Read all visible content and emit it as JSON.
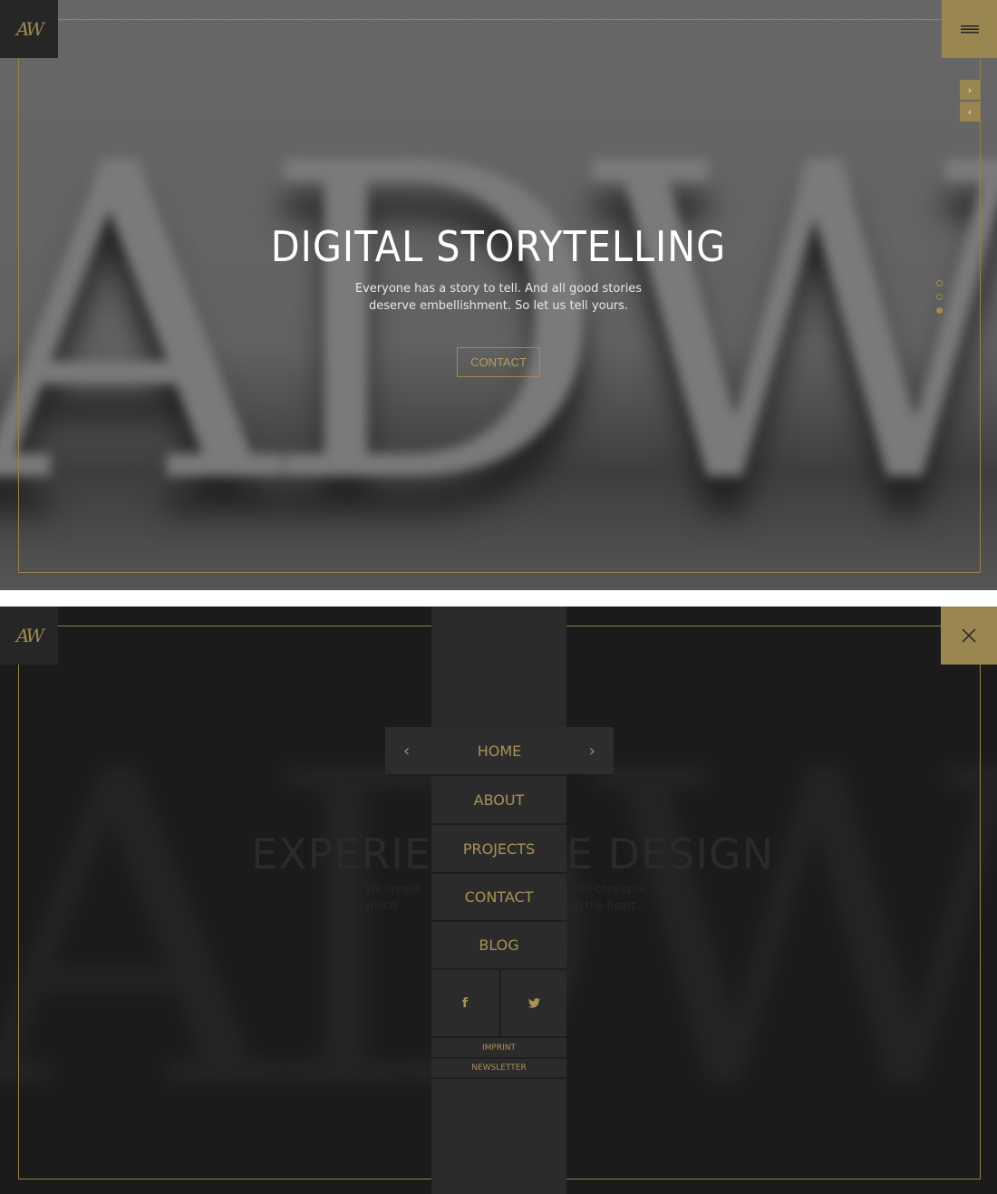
{
  "brand": {
    "logo_text": "AW",
    "accent": "#9a8650"
  },
  "slide1": {
    "background_letters": "ADW",
    "title": "DIGITAL STORYTELLING",
    "subtitle_line1": "Everyone has a story to tell. And all good stories",
    "subtitle_line2": "deserve embellishment. So let us tell yours.",
    "cta": "CONTACT",
    "slide_dots": 3,
    "active_dot": 3
  },
  "slide2": {
    "title_left": "EXPERIEN",
    "title_right": "E DESIGN",
    "sub_left1": "We create",
    "sub_right1": "and concepts,",
    "sub_left2": "which",
    "sub_right2": "th the heart."
  },
  "menu": {
    "items": [
      "HOME",
      "ABOUT",
      "PROJECTS",
      "CONTACT",
      "BLOG"
    ],
    "social": [
      "facebook-icon",
      "twitter-icon"
    ],
    "footer": [
      "IMPRINT",
      "NEWSLETTER"
    ]
  }
}
